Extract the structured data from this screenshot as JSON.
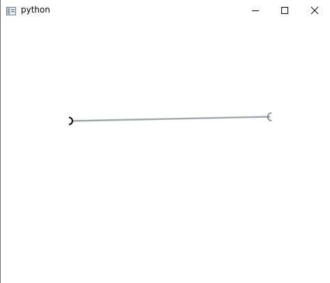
{
  "window": {
    "title": "python"
  },
  "icons": {
    "app": "python-app-icon",
    "minimize": "minimize-icon",
    "maximize": "maximize-icon",
    "close": "close-icon"
  },
  "colors": {
    "line": "#a0a8ae",
    "start_handle": "#000000",
    "end_handle": "#6e7e8c"
  }
}
